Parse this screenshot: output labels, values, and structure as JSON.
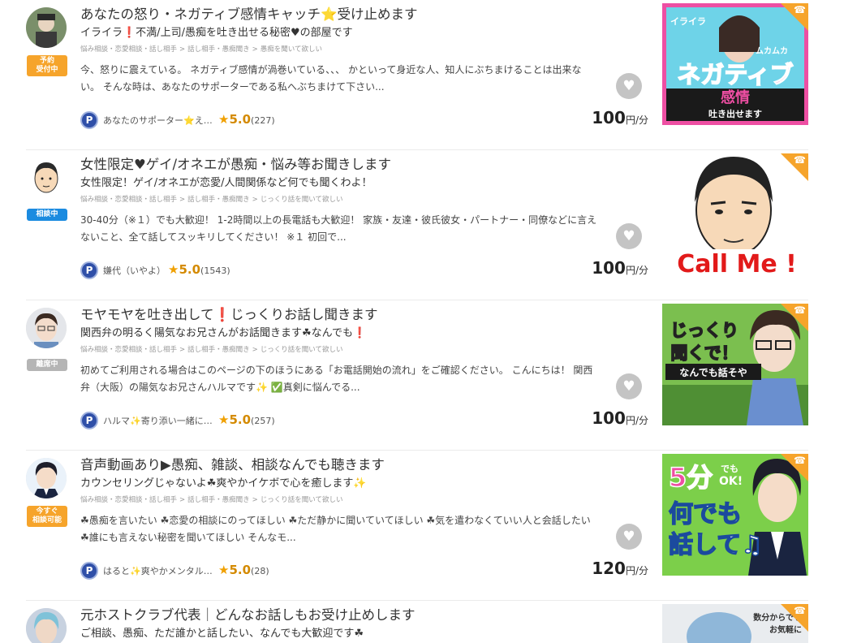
{
  "listings": [
    {
      "title": "あなたの怒り・ネガティブ感情キャッチ⭐受け止めます",
      "subtitle": "イライラ❗不満/上司/愚痴を吐き出せる秘密♥の部屋です",
      "categories": [
        "悩み相談・恋愛相談・話し相手",
        "話し相手・愚痴聞き",
        "愚痴を聞いて欲しい"
      ],
      "description": "今、怒りに震えている。 ネガティブ感情が渦巻いている、、、 かといって身近な人、知人にぶちまけることは出来ない。 そんな時は、あなたのサポーターである私へぶちまけて下さい...",
      "status": "予約\n受付中",
      "status_color": "#f6a42b",
      "profile_name": "あなたのサポーター⭐え…",
      "rating": "5.0",
      "reviews": "(227)",
      "price": "100",
      "unit": "円/分",
      "thumb_text": [
        "イライラ",
        "ムカムカ",
        "ネガティブ",
        "感情",
        "吐き出せます"
      ]
    },
    {
      "title": "女性限定♥ゲイ/オネエが愚痴・悩み等お聞きします",
      "subtitle": "女性限定！ゲイ/オネエが恋愛/人間関係など何でも聞くわよ！",
      "categories": [
        "悩み相談・恋愛相談・話し相手",
        "話し相手・愚痴聞き",
        "じっくり話を聞いて欲しい"
      ],
      "description": "30-40分（※１）でも大歓迎！ 1-2時間以上の長電話も大歓迎！ 家族・友達・彼氏彼女・パートナー・同僚などに言えないこと、全て話してスッキリしてください！ ※１ 初回で...",
      "status": "相談中",
      "status_color": "#1b8be0",
      "profile_name": "嫌代（いやよ）",
      "rating": "5.0",
      "reviews": "(1543)",
      "price": "100",
      "unit": "円/分",
      "thumb_text": [
        "Call Me !"
      ]
    },
    {
      "title": "モヤモヤを吐き出して❗じっくりお話し聞きます",
      "subtitle": "関西弁の明るく陽気なお兄さんがお話聞きます☘なんでも❗",
      "categories": [
        "悩み相談・恋愛相談・話し相手",
        "話し相手・愚痴聞き",
        "じっくり話を聞いて欲しい"
      ],
      "description": "初めてご利用される場合はこのページの下のほうにある「お電話開始の流れ」をご確認ください。 こんにちは！ 関西弁（大阪）の陽気なお兄さんハルマです✨ ✅真剣に悩んでる...",
      "status": "離席中",
      "status_color": "#b5b5b5",
      "profile_name": "ハルマ✨寄り添い一緒に…",
      "rating": "5.0",
      "reviews": "(257)",
      "price": "100",
      "unit": "円/分",
      "thumb_text": [
        "じっくり",
        "聞くで！",
        "なんでも話そや"
      ]
    },
    {
      "title": "音声動画あり▶愚痴、雑談、相談なんでも聴きます",
      "subtitle": "カウンセリングじゃないよ☘爽やかイケボで心を癒します✨",
      "categories": [
        "悩み相談・恋愛相談・話し相手",
        "話し相手・愚痴聞き",
        "じっくり話を聞いて欲しい"
      ],
      "description": "☘愚痴を言いたい ☘恋愛の相談にのってほしい ☘ただ静かに聞いていてほしい ☘気を遣わなくていい人と会話したい ☘誰にも言えない秘密を聞いてほしい そんなモ...",
      "status": "今すぐ\n相談可能",
      "status_color": "#f6a42b",
      "profile_name": "はると✨爽やかメンタル…",
      "rating": "5.0",
      "reviews": "(28)",
      "price": "120",
      "unit": "円/分",
      "thumb_text": [
        "5分",
        "でも",
        "OK!",
        "何でも",
        "話して♫"
      ]
    },
    {
      "title": "元ホストクラブ代表｜どんなお話しもお受け止めします",
      "subtitle": "ご相談、愚痴、ただ誰かと話したい、なんでも大歓迎です☘",
      "thumb_text": [
        "数分からでも",
        "お気軽に"
      ]
    }
  ],
  "colors": {
    "accent_orange": "#f6a42b",
    "star": "#f0a000",
    "p_badge": "#2f4fa8"
  },
  "icons": {
    "favorite": "heart-icon",
    "call": "phone-icon",
    "star": "star-icon",
    "point": "p-badge-icon"
  }
}
